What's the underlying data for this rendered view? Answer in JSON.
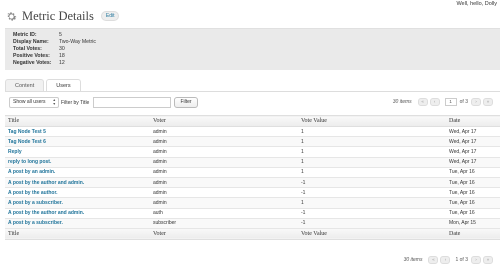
{
  "greeting": "Well, hello, Dolly",
  "header": {
    "title": "Metric Details",
    "edit_label": "Edit"
  },
  "info": [
    {
      "label": "Metric ID:",
      "value": "5"
    },
    {
      "label": "Display Name:",
      "value": "Two-Way Metric"
    },
    {
      "label": "Total Votes:",
      "value": "30"
    },
    {
      "label": "Positive Votes:",
      "value": "18"
    },
    {
      "label": "Negative Votes:",
      "value": "12"
    }
  ],
  "tabs": [
    {
      "label": "Content"
    },
    {
      "label": "Users"
    }
  ],
  "toolbar": {
    "select_value": "Show all users",
    "filter_label": "Filter by Title",
    "filter_value": "",
    "filter_button": "Filter"
  },
  "pager": {
    "items": "30 items",
    "first": "«",
    "prev": "‹",
    "page": "1",
    "of": "of 3",
    "next": "›",
    "last": "»"
  },
  "table": {
    "columns": [
      "Title",
      "Voter",
      "Vote Value",
      "Date"
    ],
    "rows": [
      {
        "title": "Tag Node Test 5",
        "voter": "admin",
        "value": "1",
        "date": "Wed, Apr 17"
      },
      {
        "title": "Tag Node Test 6",
        "voter": "admin",
        "value": "1",
        "date": "Wed, Apr 17"
      },
      {
        "title": "Reply",
        "voter": "admin",
        "value": "1",
        "date": "Wed, Apr 17"
      },
      {
        "title": "reply to long post.",
        "voter": "admin",
        "value": "1",
        "date": "Wed, Apr 17"
      },
      {
        "title": "A post by an admin.",
        "voter": "admin",
        "value": "1",
        "date": "Tue, Apr 16"
      },
      {
        "title": "A post by the author and admin.",
        "voter": "admin",
        "value": "-1",
        "date": "Tue, Apr 16"
      },
      {
        "title": "A post by the author.",
        "voter": "admin",
        "value": "-1",
        "date": "Tue, Apr 16"
      },
      {
        "title": "A post by a subscriber.",
        "voter": "admin",
        "value": "1",
        "date": "Tue, Apr 16"
      },
      {
        "title": "A post by the author and admin.",
        "voter": "auth",
        "value": "-1",
        "date": "Tue, Apr 16"
      },
      {
        "title": "A post by a subscriber.",
        "voter": "subscriber",
        "value": "-1",
        "date": "Mon, Apr 15"
      }
    ]
  }
}
